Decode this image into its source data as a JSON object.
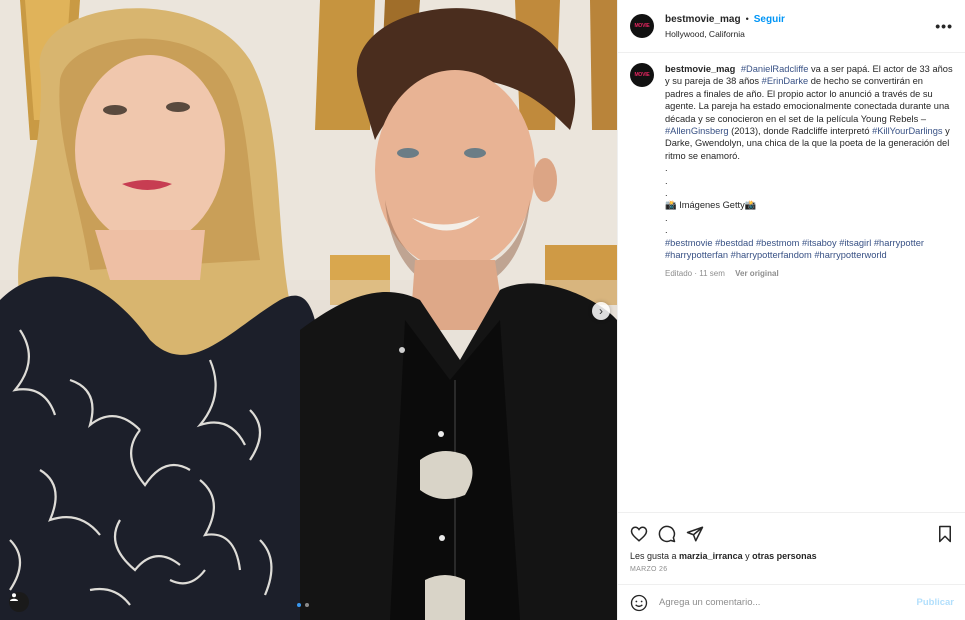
{
  "post": {
    "account": "bestmovie_mag",
    "avatar_text": "MOVIE",
    "separator": "•",
    "follow_label": "Seguir",
    "location": "Hollywood, California",
    "more_label": "•••"
  },
  "caption": {
    "username": "bestmovie_mag",
    "seg1": "#DanielRadcliffe",
    "seg2": " va a ser papá. El actor de 33 años y su pareja de 38 años ",
    "seg3": "#ErinDarke",
    "seg4": " de hecho se convertirán en padres a finales de año. El propio actor lo anunció a través de su agente. La pareja ha estado emocionalmente conectada durante una década y se conocieron en el set de la película Young Rebels – ",
    "seg5": "#AllenGinsberg",
    "seg6": " (2013), donde Radcliffe interpretó ",
    "seg7": "#KillYourDarlings",
    "seg8": " y Darke, Gwendolyn, una chica de la que la poeta de la generación del ritmo se enamoró.",
    "dot": ".",
    "credit": "📸 Imágenes Getty📸",
    "hashtags": [
      "#bestmovie",
      "#bestdad",
      "#bestmom",
      "#itsaboy",
      "#itsagirl",
      "#harrypotter",
      "#harrypotterfan",
      "#harrypotterfandom",
      "#harrypotterworld"
    ],
    "edited": "Editado · 11 sem",
    "see_original": "Ver original"
  },
  "actions": {
    "likes_prefix": "Les gusta a ",
    "likes_user": "marzia_irranca",
    "likes_middle": " y ",
    "likes_others": "otras personas",
    "date": "MARZO 26"
  },
  "comment": {
    "placeholder": "Agrega un comentario...",
    "publish_label": "Publicar"
  },
  "icons": {
    "like": "heart-icon",
    "comment": "comment-icon",
    "share": "paper-plane-icon",
    "save": "bookmark-icon",
    "emoji": "smiley-icon",
    "next": "chevron-right-icon",
    "tag": "user-tag-icon"
  },
  "colors": {
    "accent": "#0095f6",
    "hashtag": "#385185",
    "muted": "#8e8e8e"
  }
}
